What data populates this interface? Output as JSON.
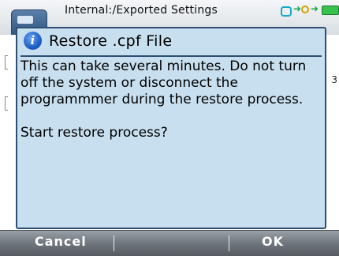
{
  "titlebar": {
    "path": "Internal:/Exported Settings",
    "app_icon": "folder-icon",
    "status_icons": [
      "usb-icon",
      "arrow-icon",
      "key-icon",
      "arrow-icon",
      "battery-icon"
    ],
    "colors": {
      "battery": "#36c24d",
      "usb": "#18a9c9"
    }
  },
  "background": {
    "partial_number": "3"
  },
  "dialog": {
    "icon": "info-icon",
    "icon_glyph": "i",
    "title": "Restore .cpf File",
    "message": "This can take several minutes. Do not turn off the system or disconnect the programmmer during the restore process.\n\nStart restore process?",
    "colors": {
      "background": "#c7dfef",
      "border": "#2d4f72"
    }
  },
  "softkeys": {
    "cancel_label": "Cancel",
    "ok_label": "OK"
  }
}
